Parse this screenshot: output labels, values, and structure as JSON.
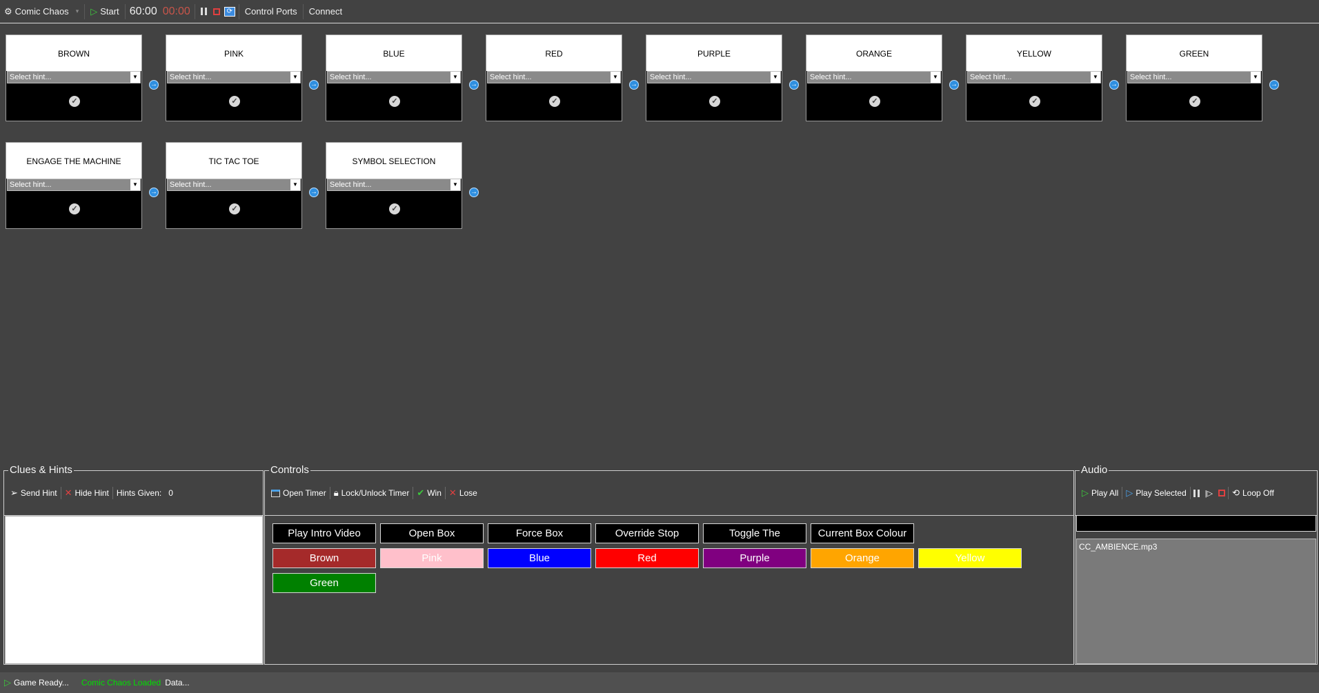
{
  "toolbar": {
    "app_name": "Comic Chaos",
    "start_label": "Start",
    "timer_total": "60:00",
    "timer_elapsed": "00:00",
    "control_ports_label": "Control Ports",
    "connect_label": "Connect"
  },
  "puzzles": [
    {
      "title": "BROWN",
      "placeholder": "Select hint..."
    },
    {
      "title": "PINK",
      "placeholder": "Select hint..."
    },
    {
      "title": "BLUE",
      "placeholder": "Select hint..."
    },
    {
      "title": "RED",
      "placeholder": "Select hint..."
    },
    {
      "title": "PURPLE",
      "placeholder": "Select hint..."
    },
    {
      "title": "ORANGE",
      "placeholder": "Select hint..."
    },
    {
      "title": "YELLOW",
      "placeholder": "Select hint..."
    },
    {
      "title": "GREEN",
      "placeholder": "Select hint..."
    },
    {
      "title": "ENGAGE THE MACHINE",
      "placeholder": "Select hint..."
    },
    {
      "title": "TIC TAC TOE",
      "placeholder": "Select hint..."
    },
    {
      "title": "SYMBOL SELECTION",
      "placeholder": "Select hint..."
    }
  ],
  "clues": {
    "title": "Clues & Hints",
    "send_hint": "Send Hint",
    "hide_hint": "Hide Hint",
    "hints_given_label": "Hints Given:",
    "hints_given_value": "0"
  },
  "controls": {
    "title": "Controls",
    "open_timer": "Open Timer",
    "lock_unlock_timer": "Lock/Unlock Timer",
    "win": "Win",
    "lose": "Lose",
    "buttons": [
      {
        "label": "Play Intro Video",
        "bg": "#000000",
        "fg": "#ffffff"
      },
      {
        "label": "Open Box",
        "bg": "#000000",
        "fg": "#ffffff"
      },
      {
        "label": "Force Box",
        "bg": "#000000",
        "fg": "#ffffff"
      },
      {
        "label": "Override Stop",
        "bg": "#000000",
        "fg": "#ffffff"
      },
      {
        "label": "Toggle The",
        "bg": "#000000",
        "fg": "#ffffff"
      },
      {
        "label": "Current Box Colour",
        "bg": "#000000",
        "fg": "#ffffff"
      },
      {
        "label": "Brown",
        "bg": "#a52a2a",
        "fg": "#ffffff"
      },
      {
        "label": "Pink",
        "bg": "#ffc0cb",
        "fg": "#ffffff"
      },
      {
        "label": "Blue",
        "bg": "#0000ff",
        "fg": "#ffffff"
      },
      {
        "label": "Red",
        "bg": "#ff0000",
        "fg": "#ffffff"
      },
      {
        "label": "Purple",
        "bg": "#800080",
        "fg": "#ffffff"
      },
      {
        "label": "Orange",
        "bg": "#ffa500",
        "fg": "#ffffff"
      },
      {
        "label": "Yellow",
        "bg": "#ffff00",
        "fg": "#ffffff"
      },
      {
        "label": "Green",
        "bg": "#008000",
        "fg": "#ffffff"
      }
    ]
  },
  "audio": {
    "title": "Audio",
    "play_all": "Play All",
    "play_selected": "Play Selected",
    "loop": "Loop Off",
    "tracks": [
      "CC_AMBIENCE.mp3"
    ]
  },
  "status": {
    "game_ready": "Game Ready...",
    "loaded": "Comic Chaos Loaded",
    "data": "Data..."
  },
  "colors": {
    "loaded_text": "#00e000",
    "timer_elapsed": "#c8554a",
    "next_arrow": "#2f8fe0"
  }
}
